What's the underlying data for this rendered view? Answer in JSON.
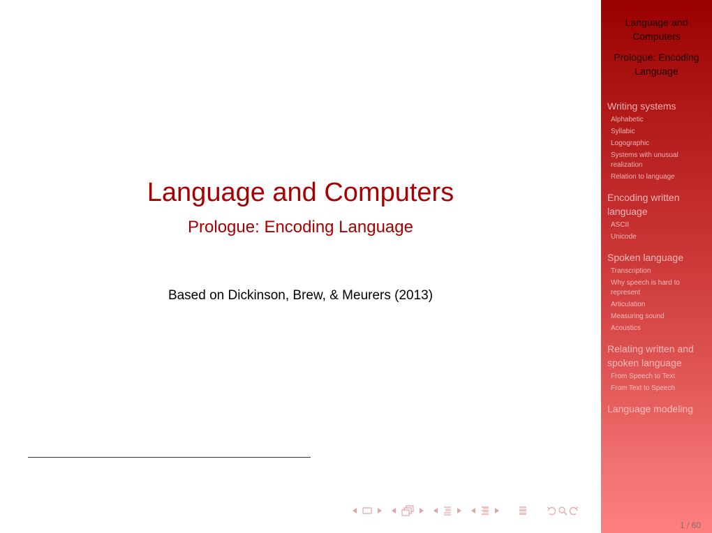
{
  "slide": {
    "title": "Language and Computers",
    "subtitle": "Prologue: Encoding Language",
    "attribution": "Based on Dickinson, Brew, & Meurers (2013)"
  },
  "sidebar": {
    "title": "Language and Computers",
    "subtitle": "Prologue: Encoding Language",
    "sections": [
      {
        "label": "Writing systems",
        "color": "#f2b0b0",
        "items": [
          {
            "label": "Alphabetic",
            "color": "#f0b0b0"
          },
          {
            "label": "Syllabic",
            "color": "#f0b0b0"
          },
          {
            "label": "Logographic",
            "color": "#f0b0b0"
          },
          {
            "label": "Systems with unusual realization",
            "color": "#f0b0b0"
          },
          {
            "label": "Relation to language",
            "color": "#f0b0b0"
          }
        ]
      },
      {
        "label": "Encoding written language",
        "color": "#f5b8b8",
        "items": [
          {
            "label": "ASCII",
            "color": "#f5b8b8"
          },
          {
            "label": "Unicode",
            "color": "#f5b8b8"
          }
        ]
      },
      {
        "label": "Spoken language",
        "color": "#f7baba",
        "items": [
          {
            "label": "Transcription",
            "color": "#f7baba"
          },
          {
            "label": "Why speech is hard to represent",
            "color": "#f7baba"
          },
          {
            "label": "Articulation",
            "color": "#f7baba"
          },
          {
            "label": "Measuring sound",
            "color": "#f7baba"
          },
          {
            "label": "Acoustics",
            "color": "#f7baba"
          }
        ]
      },
      {
        "label": "Relating written and spoken language",
        "color": "#fbbcbc",
        "items": [
          {
            "label": "From Speech to Text",
            "color": "#fbbcbc"
          },
          {
            "label": "From Text to Speech",
            "color": "#fbbcbc"
          }
        ]
      },
      {
        "label": "Language modeling",
        "color": "#ffbfbf",
        "items": []
      }
    ],
    "page_number": "1 / 60"
  },
  "navigation": {
    "icons": [
      "prev-slide-arrow",
      "slide-icon",
      "next-slide-arrow",
      "prev-frame-arrow",
      "frame-icon",
      "next-frame-arrow",
      "prev-subsection-arrow",
      "subsection-icon",
      "next-subsection-arrow",
      "prev-section-arrow",
      "section-icon",
      "next-section-arrow",
      "document-icon",
      "undo-icon",
      "search-icon",
      "redo-icon"
    ],
    "icon_color": "#e3a3a3"
  }
}
